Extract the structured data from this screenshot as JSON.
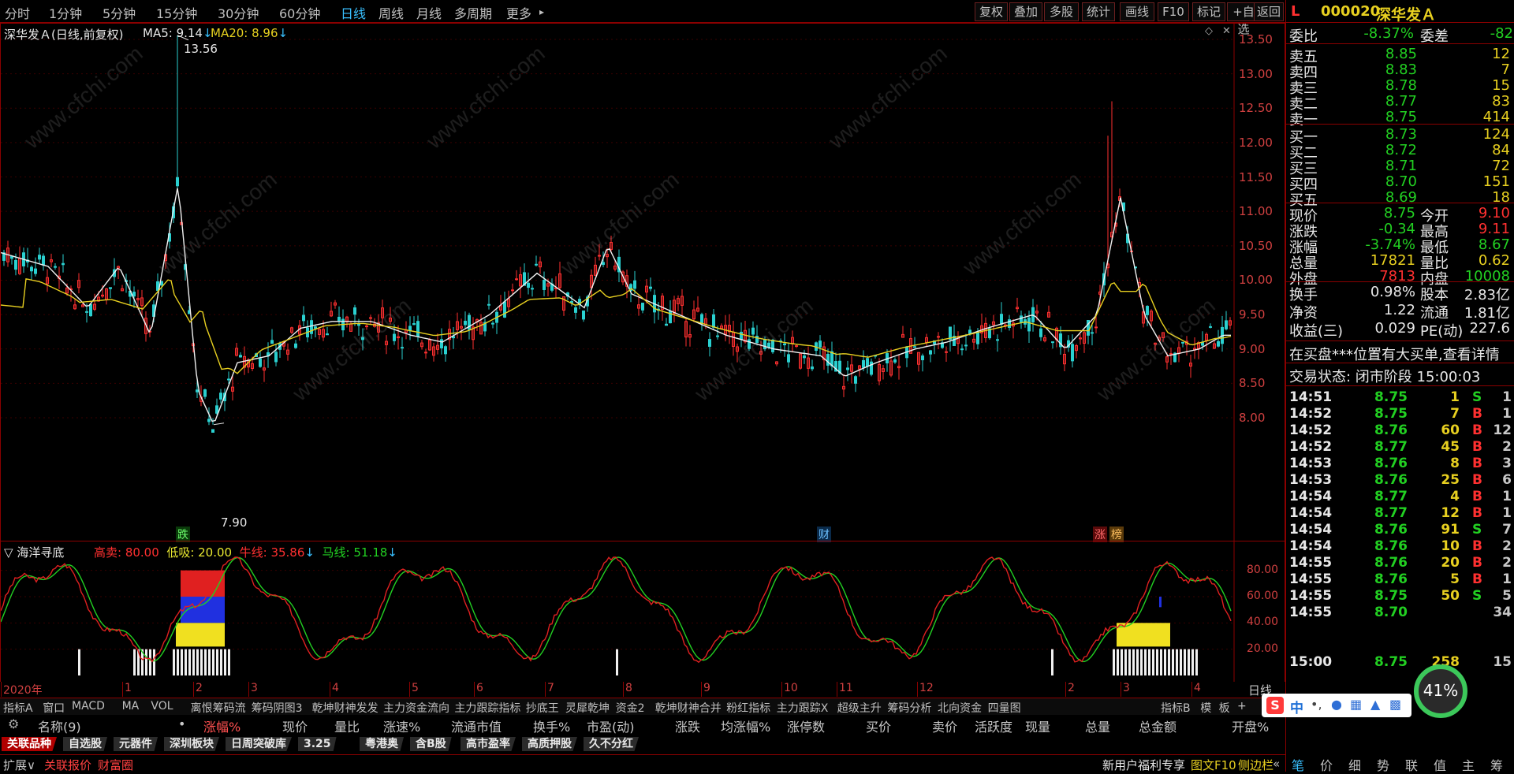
{
  "topbar": {
    "periods": [
      "分时",
      "1分钟",
      "5分钟",
      "15分钟",
      "30分钟",
      "60分钟",
      "日线",
      "周线",
      "月线",
      "多周期",
      "更多"
    ],
    "active_period": "日线",
    "more_arrow": "▸",
    "right_buttons": [
      "复权",
      "叠加",
      "多股",
      "统计",
      "画线",
      "F10",
      "标记",
      "+自选",
      "返回"
    ]
  },
  "main_chart": {
    "stock_title": "深华发Ａ(日线,前复权)",
    "ma5_label": "MA5: 9.14",
    "ma20_label": "MA20: 8.96",
    "arrow_down": "↓",
    "high_label": "13.56",
    "low_label": "7.90",
    "price_ticks": [
      "13.50",
      "13.00",
      "12.50",
      "12.00",
      "11.50",
      "11.00",
      "10.50",
      "10.00",
      "9.50",
      "9.00",
      "8.50",
      "8.00"
    ],
    "event_tags": [
      "跌",
      "财",
      "涨",
      "榜"
    ],
    "watermark": "www.cfchi.com"
  },
  "indicator": {
    "name": "海洋寻底",
    "gaomai": "高卖: 80.00",
    "dixi": "低吸: 20.00",
    "niuxian": "牛线: 35.86",
    "maxian": "马线: 51.18",
    "ticks": [
      "80.00",
      "60.00",
      "40.00",
      "20.00"
    ]
  },
  "date_axis": {
    "labels": [
      "2020年",
      "1",
      "2",
      "3",
      "4",
      "5",
      "6",
      "7",
      "8",
      "9",
      "10",
      "11",
      "12",
      "2",
      "3",
      "4"
    ],
    "right_label": "日线"
  },
  "indicator_tabs": [
    "指标A",
    "窗口",
    "MACD",
    "MA",
    "VOL",
    "离恨筹码流",
    "筹码阴图3",
    "乾坤财神发发",
    "主力资金流向",
    "主力跟踪指标",
    "抄底王",
    "灵犀乾坤",
    "资金2",
    "乾坤财神合并",
    "粉红指标",
    "主力跟踪X",
    "超级主升",
    "筹码分析",
    "北向资金",
    "四量图",
    "指标B",
    "模",
    "板",
    "+"
  ],
  "column_headers": [
    "名称(9)",
    "•",
    "涨幅%",
    "现价",
    "量比",
    "涨速%",
    "流通市值",
    "换手%",
    "市盈(动)",
    "涨跌",
    "均涨幅%",
    "涨停数",
    "买价",
    "卖价",
    "活跃度",
    "现量",
    "总量",
    "总金额",
    "开盘%"
  ],
  "sector_tabs": [
    "关联品种",
    "自选股",
    "元器件",
    "深圳板块",
    "日周突破库",
    "3.25",
    "粤港奥",
    "含B股",
    "高市盈率",
    "高质押股",
    "久不分红"
  ],
  "statusbar": {
    "left": [
      "扩展∨",
      "关联报价",
      "财富圈"
    ],
    "right_promo": "新用户福利专享",
    "right_f10": "图文F10",
    "right_side": "侧边栏",
    "right_arrow": "«"
  },
  "quote_panel": {
    "flag": "L",
    "code": "000020",
    "name": "深华发Ａ",
    "weibi_label": "委比",
    "weibi": "-8.37%",
    "weicha_label": "委差",
    "weicha": "-82",
    "asks": [
      {
        "label": "卖五",
        "price": "8.85",
        "vol": "12"
      },
      {
        "label": "卖四",
        "price": "8.83",
        "vol": "7"
      },
      {
        "label": "卖三",
        "price": "8.78",
        "vol": "15"
      },
      {
        "label": "卖二",
        "price": "8.77",
        "vol": "83"
      },
      {
        "label": "卖一",
        "price": "8.75",
        "vol": "414"
      }
    ],
    "bids": [
      {
        "label": "买一",
        "price": "8.73",
        "vol": "124"
      },
      {
        "label": "买二",
        "price": "8.72",
        "vol": "84"
      },
      {
        "label": "买三",
        "price": "8.71",
        "vol": "72"
      },
      {
        "label": "买四",
        "price": "8.70",
        "vol": "151"
      },
      {
        "label": "买五",
        "price": "8.69",
        "vol": "18"
      }
    ],
    "stats": [
      {
        "l1": "现价",
        "v1": "8.75",
        "l2": "今开",
        "v2": "9.10"
      },
      {
        "l1": "涨跌",
        "v1": "-0.34",
        "l2": "最高",
        "v2": "9.11"
      },
      {
        "l1": "涨幅",
        "v1": "-3.74%",
        "l2": "最低",
        "v2": "8.67"
      },
      {
        "l1": "总量",
        "v1": "17821",
        "l2": "量比",
        "v2": "0.62"
      },
      {
        "l1": "外盘",
        "v1": "7813",
        "l2": "内盘",
        "v2": "10008"
      }
    ],
    "stats2": [
      {
        "l1": "换手",
        "v1": "0.98%",
        "l2": "股本",
        "v2": "2.83亿"
      },
      {
        "l1": "净资",
        "v1": "1.22",
        "l2": "流通",
        "v2": "1.81亿"
      },
      {
        "l1": "收益(三)",
        "v1": "0.029",
        "l2": "PE(动)",
        "v2": "227.6"
      }
    ],
    "notice": "在买盘***位置有大买单,查看详情",
    "trade_state": "交易状态: 闭市阶段 15:00:03",
    "ticks": [
      {
        "t": "14:51",
        "p": "8.75",
        "v": "1",
        "d": "S",
        "n": "1"
      },
      {
        "t": "14:52",
        "p": "8.75",
        "v": "7",
        "d": "B",
        "n": "1"
      },
      {
        "t": "14:52",
        "p": "8.76",
        "v": "60",
        "d": "B",
        "n": "12"
      },
      {
        "t": "14:52",
        "p": "8.77",
        "v": "45",
        "d": "B",
        "n": "2"
      },
      {
        "t": "14:53",
        "p": "8.76",
        "v": "8",
        "d": "B",
        "n": "3"
      },
      {
        "t": "14:53",
        "p": "8.76",
        "v": "25",
        "d": "B",
        "n": "6"
      },
      {
        "t": "14:54",
        "p": "8.77",
        "v": "4",
        "d": "B",
        "n": "1"
      },
      {
        "t": "14:54",
        "p": "8.77",
        "v": "12",
        "d": "B",
        "n": "1"
      },
      {
        "t": "14:54",
        "p": "8.76",
        "v": "91",
        "d": "S",
        "n": "7"
      },
      {
        "t": "14:54",
        "p": "8.76",
        "v": "10",
        "d": "B",
        "n": "2"
      },
      {
        "t": "14:55",
        "p": "8.76",
        "v": "20",
        "d": "B",
        "n": "2"
      },
      {
        "t": "14:55",
        "p": "8.76",
        "v": "5",
        "d": "B",
        "n": "1"
      },
      {
        "t": "14:55",
        "p": "8.75",
        "v": "50",
        "d": "S",
        "n": "5"
      },
      {
        "t": "14:55",
        "p": "8.70",
        "v": "",
        "d": "",
        "n": "34"
      },
      {
        "t": "",
        "p": "",
        "v": "",
        "d": "",
        "n": ""
      },
      {
        "t": "",
        "p": "",
        "v": "",
        "d": "",
        "n": ""
      },
      {
        "t": "15:00",
        "p": "8.75",
        "v": "258",
        "d": "",
        "n": "15"
      }
    ],
    "bottom_tabs": [
      "笔",
      "价",
      "细",
      "势",
      "联",
      "值",
      "主",
      "筹"
    ]
  },
  "overlays": {
    "speed_percent": "41%",
    "ime_label": "中"
  },
  "colors": {
    "up": "#ff3030",
    "down": "#22d022",
    "accent": "#39c0ff",
    "frame": "#8b0000"
  }
}
